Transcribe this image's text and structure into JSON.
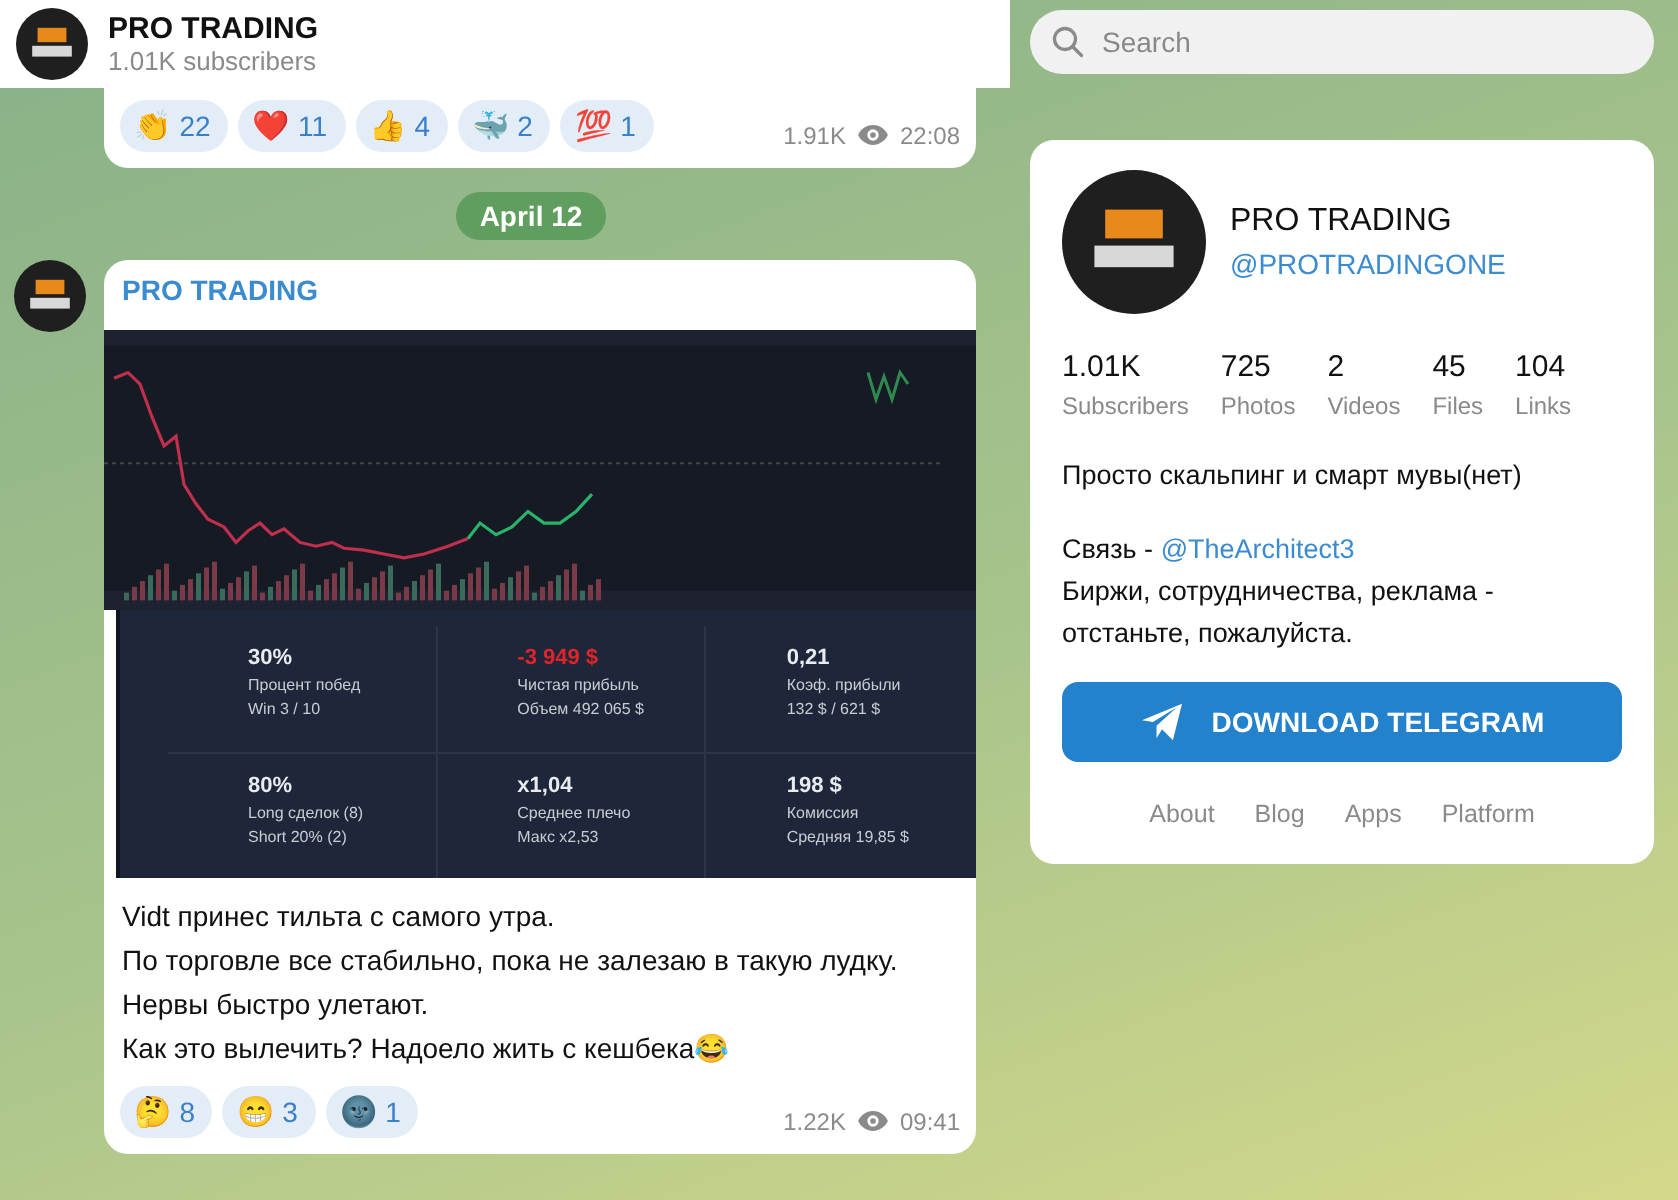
{
  "header": {
    "title": "PRO TRADING",
    "subtitle": "1.01K subscribers"
  },
  "search": {
    "placeholder": "Search"
  },
  "feed": [
    {
      "kind": "message",
      "reactions": [
        {
          "emoji": "👏",
          "count": "22"
        },
        {
          "emoji": "❤️",
          "count": "11"
        },
        {
          "emoji": "👍",
          "count": "4"
        },
        {
          "emoji": "🐳",
          "count": "2"
        },
        {
          "emoji": "💯",
          "count": "1"
        }
      ],
      "views": "1.91K",
      "time": "22:08"
    },
    {
      "kind": "date",
      "label": "April 12"
    },
    {
      "kind": "message",
      "author": "PRO TRADING",
      "stats": [
        {
          "value": "30%",
          "label": "Процент побед",
          "detail": "Win 3 / 10",
          "negative": false
        },
        {
          "value": "-3 949 $",
          "label": "Чистая прибыль",
          "detail": "Объем 492 065 $",
          "negative": true
        },
        {
          "value": "0,21",
          "label": "Коэф. прибыли",
          "detail": "132 $ / 621 $",
          "negative": false
        },
        {
          "value": "80%",
          "label": "Long сделок (8)",
          "detail": "Short 20% (2)",
          "negative": false
        },
        {
          "value": "x1,04",
          "label": "Среднее плечо",
          "detail": "Макс x2,53",
          "negative": false
        },
        {
          "value": "198 $",
          "label": "Комиссия",
          "detail": "Средняя 19,85 $",
          "negative": false
        }
      ],
      "text": "Vidt принес тильта с самого утра.\nПо торговле все стабильно, пока не залезаю в такую лудку.\nНервы быстро улетают.\nКак это вылечить? Надоело жить с кешбека😂",
      "reactions": [
        {
          "emoji": "🤔",
          "count": "8"
        },
        {
          "emoji": "😁",
          "count": "3"
        },
        {
          "emoji": "🌚",
          "count": "1"
        }
      ],
      "views": "1.22K",
      "time": "09:41"
    }
  ],
  "profile": {
    "name": "PRO TRADING",
    "username": "@PROTRADINGONE",
    "counters": [
      {
        "value": "1.01K",
        "label": "Subscribers"
      },
      {
        "value": "725",
        "label": "Photos"
      },
      {
        "value": "2",
        "label": "Videos"
      },
      {
        "value": "45",
        "label": "Files"
      },
      {
        "value": "104",
        "label": "Links"
      }
    ],
    "description": "Просто скальпинг и смарт мувы(нет)",
    "contact_label": "Связь -",
    "contact_link": "@TheArchitect3",
    "note": "Биржи, сотрудничества, реклама - отстаньте, пожалуйста.",
    "button": "DOWNLOAD TELEGRAM",
    "links": [
      "About",
      "Blog",
      "Apps",
      "Platform"
    ]
  }
}
